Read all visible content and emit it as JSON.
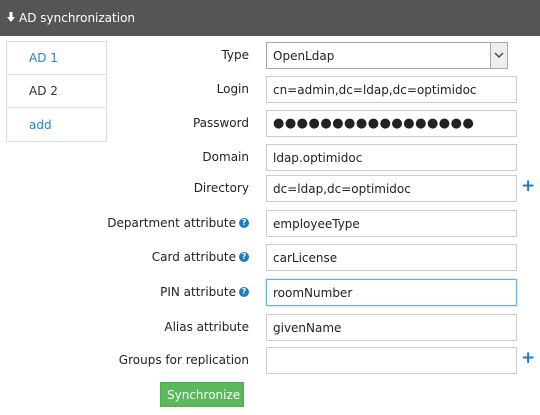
{
  "header": {
    "title": "AD synchronization",
    "icon": "arrow-down-icon"
  },
  "tabs": [
    {
      "label": "AD 1"
    },
    {
      "label": "AD 2"
    },
    {
      "label": "add"
    }
  ],
  "form": {
    "type": {
      "label": "Type",
      "value": "OpenLdap"
    },
    "login": {
      "label": "Login",
      "value": "cn=admin,dc=ldap,dc=optimidoc"
    },
    "password": {
      "label": "Password",
      "value": "●●●●●●●●●●●●●●●●●"
    },
    "domain": {
      "label": "Domain",
      "value": "ldap.optimidoc"
    },
    "directory": {
      "label": "Directory",
      "value": "dc=ldap,dc=optimidoc"
    },
    "department_attribute": {
      "label": "Department attribute",
      "value": "employeeType"
    },
    "card_attribute": {
      "label": "Card attribute",
      "value": "carLicense"
    },
    "pin_attribute": {
      "label": "PIN attribute",
      "value": "roomNumber"
    },
    "alias_attribute": {
      "label": "Alias attribute",
      "value": "givenName"
    },
    "groups_for_replication": {
      "label": "Groups for replication",
      "value": ""
    }
  },
  "help_glyph": "?",
  "plus_glyph": "+",
  "synchronize_label": "Synchronize"
}
